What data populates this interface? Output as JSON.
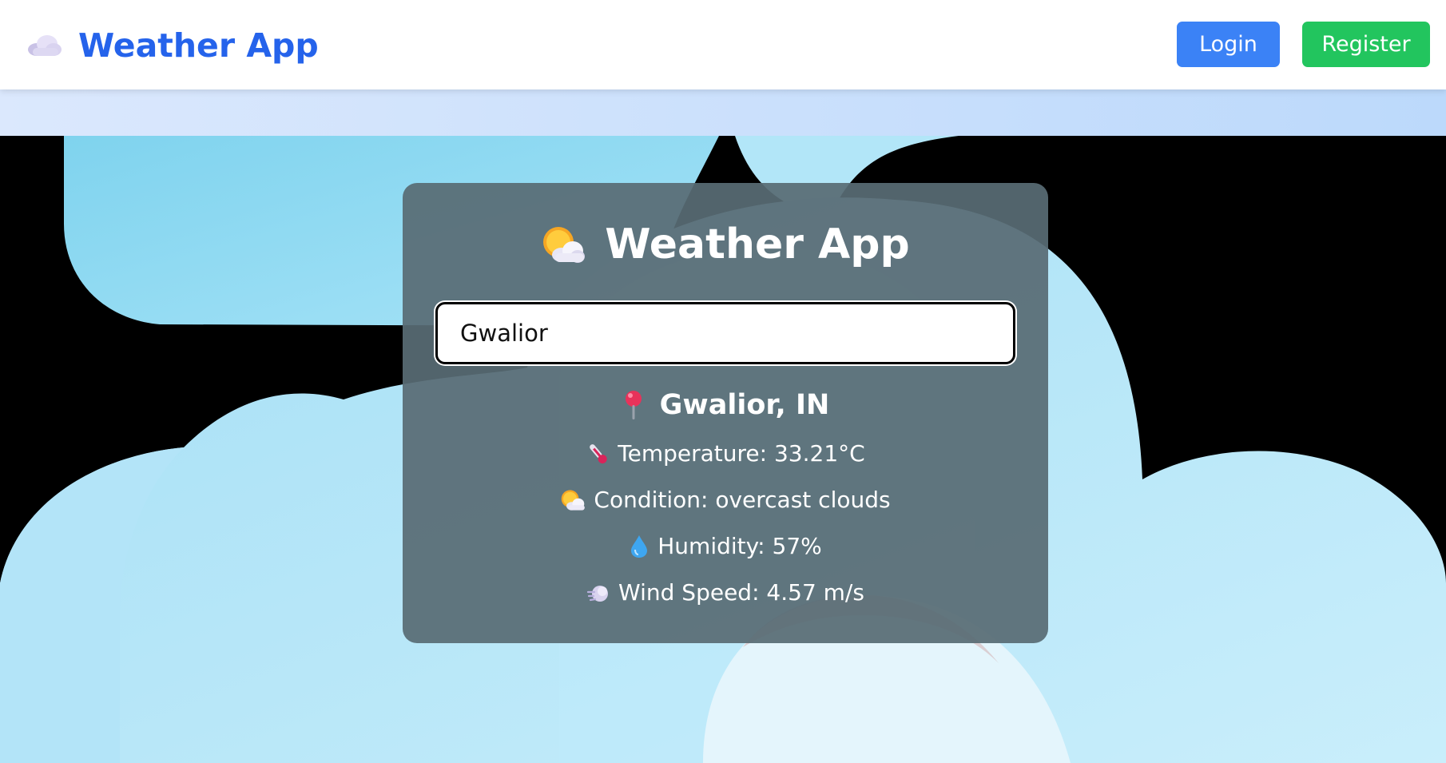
{
  "navbar": {
    "brand_title": "Weather App",
    "brand_icon": "cloud-icon",
    "login_label": "Login",
    "register_label": "Register",
    "colors": {
      "brand": "#2563eb",
      "login": "#3b82f6",
      "register": "#22c55e"
    }
  },
  "card": {
    "title": "Weather App",
    "title_icon": "sun-behind-cloud-icon",
    "search": {
      "value": "Gwalior",
      "placeholder": ""
    },
    "location": "Gwalior, IN",
    "details": {
      "temperature": "Temperature: 33.21°C",
      "condition": "Condition: overcast clouds",
      "humidity": "Humidity: 57%",
      "wind": "Wind Speed: 4.57 m/s"
    }
  }
}
